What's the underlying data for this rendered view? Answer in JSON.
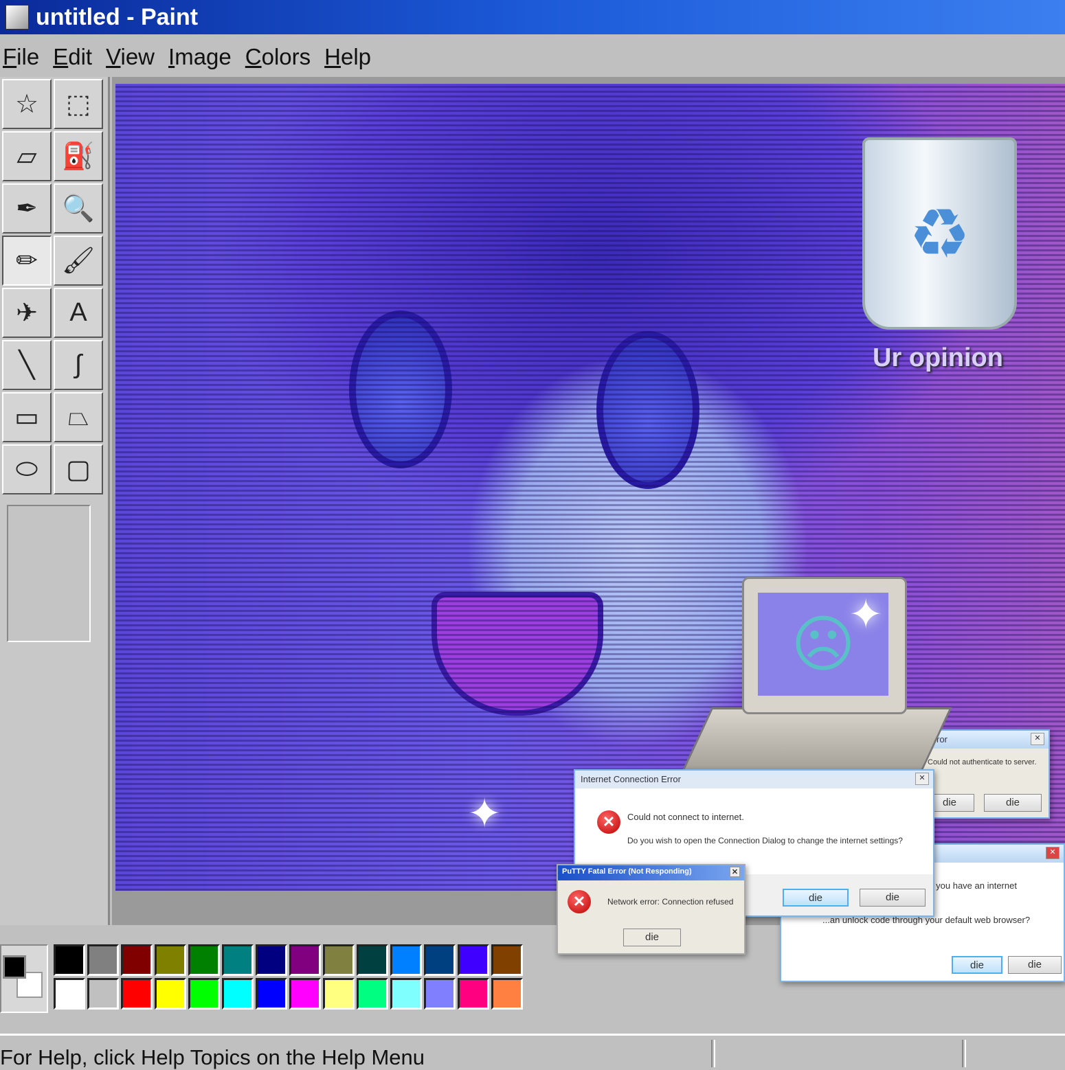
{
  "window": {
    "title": "untitled - Paint"
  },
  "menu": [
    "File",
    "Edit",
    "View",
    "Image",
    "Colors",
    "Help"
  ],
  "tools": [
    {
      "name": "free-form-select",
      "glyph": "☆"
    },
    {
      "name": "rect-select",
      "glyph": "⬚"
    },
    {
      "name": "eraser",
      "glyph": "▱"
    },
    {
      "name": "fill",
      "glyph": "⛽"
    },
    {
      "name": "color-picker",
      "glyph": "✒"
    },
    {
      "name": "magnifier",
      "glyph": "🔍"
    },
    {
      "name": "pencil",
      "glyph": "✏"
    },
    {
      "name": "brush",
      "glyph": "🖌"
    },
    {
      "name": "airbrush",
      "glyph": "✈"
    },
    {
      "name": "text",
      "glyph": "A"
    },
    {
      "name": "line",
      "glyph": "╲"
    },
    {
      "name": "curve",
      "glyph": "∫"
    },
    {
      "name": "rectangle",
      "glyph": "▭"
    },
    {
      "name": "polygon",
      "glyph": "⏢"
    },
    {
      "name": "ellipse",
      "glyph": "⬭"
    },
    {
      "name": "rounded-rect",
      "glyph": "▢"
    }
  ],
  "selected_tool": "pencil",
  "desktop": {
    "recycle_bin_label": "Ur opinion"
  },
  "dialogs": {
    "auth": {
      "title": "Error",
      "message": "Could not authenticate to server.",
      "buttons": [
        "die",
        "die"
      ]
    },
    "internet": {
      "title": "Internet Connection Error",
      "message": "Could not connect to internet.",
      "question": "Do you wish to open the Connection Dialog to change the internet settings?",
      "buttons": [
        "die",
        "die"
      ]
    },
    "putty": {
      "title": "PuTTY Fatal Error (Not Responding)",
      "message": "Network error: Connection refused",
      "button": "die"
    },
    "unlock": {
      "message": "...make sure you have an internet",
      "question": "...an unlock code through your default web browser?",
      "buttons": [
        "die",
        "die"
      ]
    }
  },
  "palette": {
    "foreground": "#000000",
    "background": "#ffffff",
    "colors": [
      "#000000",
      "#808080",
      "#800000",
      "#808000",
      "#008000",
      "#008080",
      "#000080",
      "#800080",
      "#808040",
      "#004040",
      "#0080ff",
      "#004080",
      "#4000ff",
      "#804000",
      "#ffffff",
      "#c0c0c0",
      "#ff0000",
      "#ffff00",
      "#00ff00",
      "#00ffff",
      "#0000ff",
      "#ff00ff",
      "#ffff80",
      "#00ff80",
      "#80ffff",
      "#8080ff",
      "#ff0080",
      "#ff8040"
    ]
  },
  "status": {
    "text": "For Help, click Help Topics on the Help Menu"
  }
}
